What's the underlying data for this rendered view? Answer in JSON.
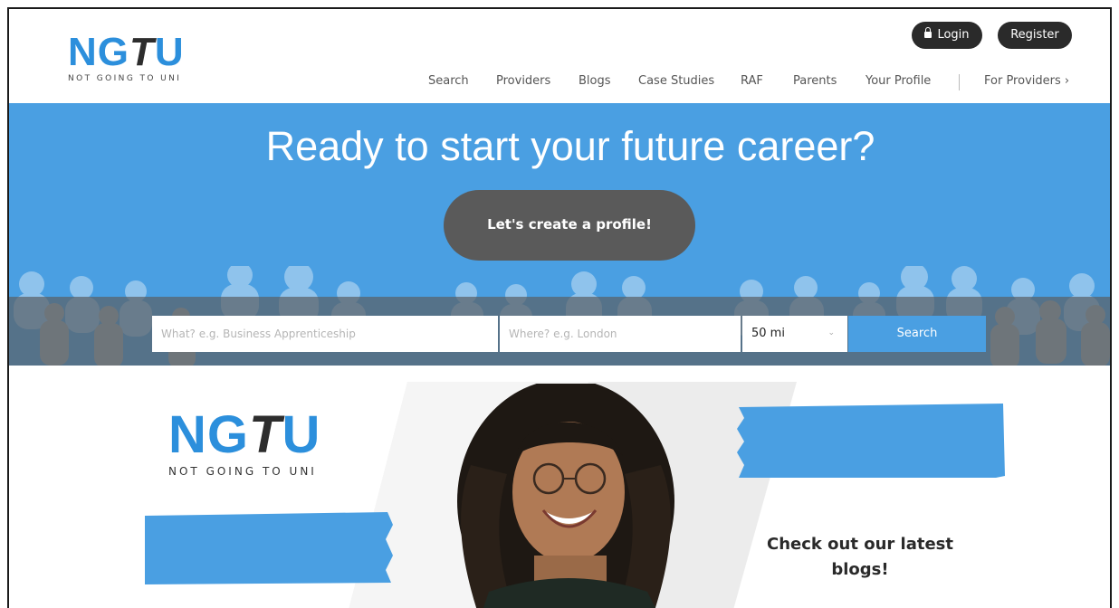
{
  "brand": {
    "logo_blue": "NG",
    "logo_dark": "T",
    "logo_end": "U",
    "tagline": "NOT GOING TO UNI",
    "accent_color": "#4a9fe2",
    "dark_color": "#2a2a2a"
  },
  "auth": {
    "login_label": "Login",
    "login_icon": "lock-icon",
    "register_label": "Register"
  },
  "nav": {
    "items": [
      {
        "label": "Search"
      },
      {
        "label": "Providers"
      },
      {
        "label": "Blogs"
      },
      {
        "label": "Case Studies"
      },
      {
        "label": "RAF"
      },
      {
        "label": "Parents"
      },
      {
        "label": "Your Profile"
      }
    ],
    "for_providers": "For Providers ›"
  },
  "hero": {
    "title": "Ready to start your future career?",
    "cta_label": "Let's create a profile!"
  },
  "search": {
    "what_placeholder": "What? e.g. Business Apprenticeship",
    "where_placeholder": "Where? e.g. London",
    "radius_value": "50 mi",
    "chevron_icon": "chevron-down-icon",
    "button_label": "Search"
  },
  "banner": {
    "logo_blue": "NG",
    "logo_dark": "T",
    "logo_end": "U",
    "tagline": "NOT GOING TO UNI",
    "cta_line1": "Check out our latest",
    "cta_line2": "blogs!"
  }
}
